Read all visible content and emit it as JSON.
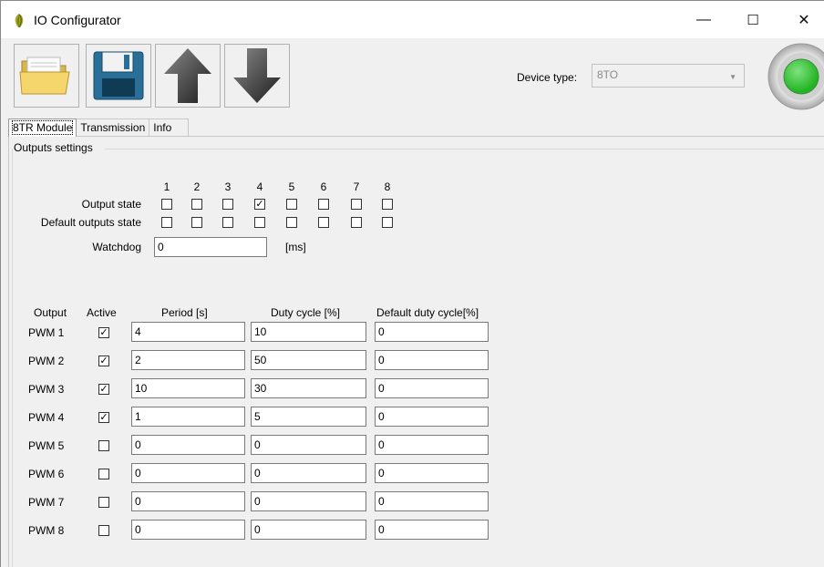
{
  "window": {
    "title": "IO Configurator",
    "minimize_glyph": "—",
    "maximize_glyph": "☐",
    "close_glyph": "✕"
  },
  "toolbar": {
    "buttons": [
      {
        "name": "open-folder-icon"
      },
      {
        "name": "save-floppy-icon"
      },
      {
        "name": "upload-arrow-icon"
      },
      {
        "name": "download-arrow-icon"
      }
    ],
    "device_type_label": "Device type:",
    "device_type_value": "8TO",
    "status_color": "#22b422"
  },
  "tabs": [
    "8TR Module",
    "Transmission",
    "Info"
  ],
  "outputs_settings": {
    "group_title": "Outputs settings",
    "columns": [
      "1",
      "2",
      "3",
      "4",
      "5",
      "6",
      "7",
      "8"
    ],
    "output_state_label": "Output state",
    "output_state": [
      false,
      false,
      false,
      true,
      false,
      false,
      false,
      false
    ],
    "default_outputs_state_label": "Default outputs state",
    "default_outputs_state": [
      false,
      false,
      false,
      false,
      false,
      false,
      false,
      false
    ],
    "watchdog_label": "Watchdog",
    "watchdog_value": "0",
    "watchdog_unit": "[ms]"
  },
  "pwm_table": {
    "headers": {
      "output": "Output",
      "active": "Active",
      "period": "Period [s]",
      "duty": "Duty cycle [%]",
      "default_duty": "Default duty cycle[%]"
    },
    "rows": [
      {
        "label": "PWM 1",
        "active": true,
        "period": "4",
        "duty": "10",
        "default_duty": "0"
      },
      {
        "label": "PWM 2",
        "active": true,
        "period": "2",
        "duty": "50",
        "default_duty": "0"
      },
      {
        "label": "PWM 3",
        "active": true,
        "period": "10",
        "duty": "30",
        "default_duty": "0"
      },
      {
        "label": "PWM 4",
        "active": true,
        "period": "1",
        "duty": "5",
        "default_duty": "0"
      },
      {
        "label": "PWM 5",
        "active": false,
        "period": "0",
        "duty": "0",
        "default_duty": "0"
      },
      {
        "label": "PWM 6",
        "active": false,
        "period": "0",
        "duty": "0",
        "default_duty": "0"
      },
      {
        "label": "PWM 7",
        "active": false,
        "period": "0",
        "duty": "0",
        "default_duty": "0"
      },
      {
        "label": "PWM 8",
        "active": false,
        "period": "0",
        "duty": "0",
        "default_duty": "0"
      }
    ]
  }
}
